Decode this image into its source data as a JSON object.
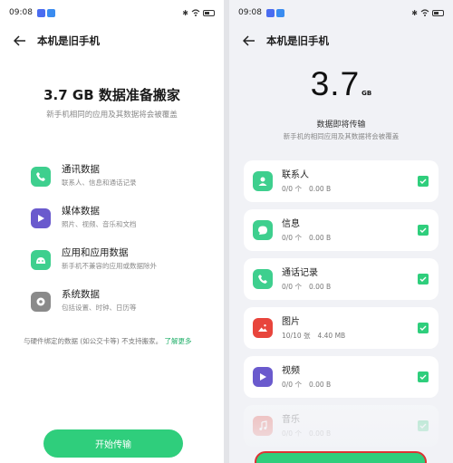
{
  "left": {
    "status": {
      "time": "09:08",
      "badge1_color": "#4a6cf0",
      "badge2_color": "#3a8cf0"
    },
    "header": {
      "title": "本机是旧手机"
    },
    "hero": {
      "title": "3.7 GB 数据准备搬家",
      "subtitle": "新手机相同的应用及其数据将会被覆盖"
    },
    "categories": [
      {
        "name": "通讯数据",
        "desc": "联系人、信息和通话记录",
        "icon": "phone-icon",
        "color": "#3ecf8e"
      },
      {
        "name": "媒体数据",
        "desc": "照片、视频、音乐和文档",
        "icon": "play-icon",
        "color": "#6a5acd"
      },
      {
        "name": "应用和应用数据",
        "desc": "新手机不兼容的应用或数据除外",
        "icon": "android-icon",
        "color": "#3ecf8e"
      },
      {
        "name": "系统数据",
        "desc": "包括设置、时钟、日历等",
        "icon": "system-gear-icon",
        "color": "#8a8a8a"
      }
    ],
    "note": {
      "text": "与硬件绑定的数据 (如公交卡等) 不支持搬家。",
      "link": "了解更多"
    },
    "start_button": "开始传输"
  },
  "right": {
    "status": {
      "time": "09:08"
    },
    "header": {
      "title": "本机是旧手机"
    },
    "size": {
      "value": "3.7",
      "unit": "GB"
    },
    "subtitle1": "数据即将传输",
    "subtitle2": "新手机的相同应用及其数据将会被覆盖",
    "items": [
      {
        "name": "联系人",
        "count": "0/0 个",
        "size": "0.00 B",
        "icon": "contact-icon",
        "color": "#3ecf8e"
      },
      {
        "name": "信息",
        "count": "0/0 个",
        "size": "0.00 B",
        "icon": "message-icon",
        "color": "#3ecf8e"
      },
      {
        "name": "通话记录",
        "count": "0/0 个",
        "size": "0.00 B",
        "icon": "phone-icon",
        "color": "#3ecf8e"
      },
      {
        "name": "图片",
        "count": "10/10 张",
        "size": "4.40 MB",
        "icon": "picture-icon",
        "color": "#e8453c"
      },
      {
        "name": "视频",
        "count": "0/0 个",
        "size": "0.00 B",
        "icon": "video-icon",
        "color": "#6a5acd"
      },
      {
        "name": "音乐",
        "count": "0/0 个",
        "size": "0.00 B",
        "icon": "music-icon",
        "color": "#e8453c"
      }
    ],
    "accent": "#2fce7c"
  }
}
